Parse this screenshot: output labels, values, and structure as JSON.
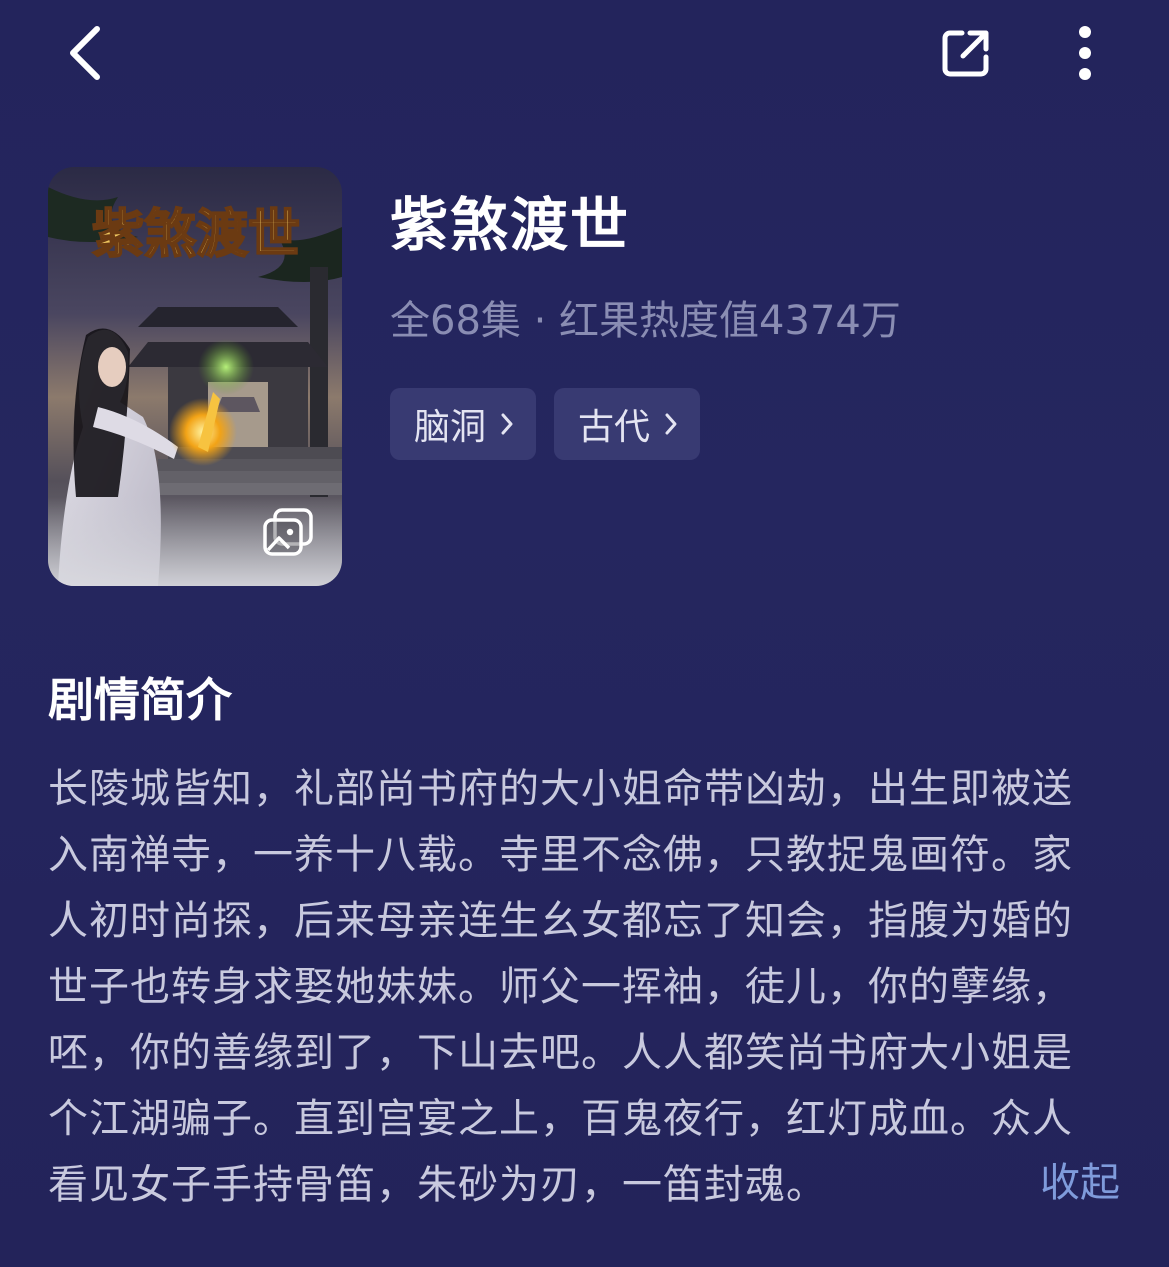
{
  "header": {
    "back_icon": "chevron-left-icon",
    "share_icon": "share-icon",
    "more_icon": "more-vertical-icon"
  },
  "drama": {
    "cover_title_art": "紫煞渡世",
    "title": "紫煞渡世",
    "meta": "全68集 · 红果热度值4374万",
    "tags": [
      {
        "label": "脑洞"
      },
      {
        "label": "古代"
      }
    ]
  },
  "synopsis": {
    "heading": "剧情简介",
    "lines": [
      "长陵城皆知，礼部尚书府的大小姐命带凶劫，出生即被送",
      "入南禅寺，一养十八载。寺里不念佛，只教捉鬼画符。家",
      "人初时尚探，后来母亲连生幺女都忘了知会，指腹为婚的",
      "世子也转身求娶她妹妹。师父一挥袖，徒儿，你的孽缘，",
      "呸，你的善缘到了，下山去吧。人人都笑尚书府大小姐是",
      "个江湖骗子。直到宫宴之上，百鬼夜行，红灯成血。众人",
      "看见女子手持骨笛，朱砂为刃，一笛封魂。"
    ],
    "collapse_label": "收起"
  },
  "colors": {
    "background": "#23245c",
    "tag_bg": "#383a72",
    "meta_text": "#8a8db3",
    "body_text": "#c8c9de",
    "link": "#7f9bdb"
  }
}
